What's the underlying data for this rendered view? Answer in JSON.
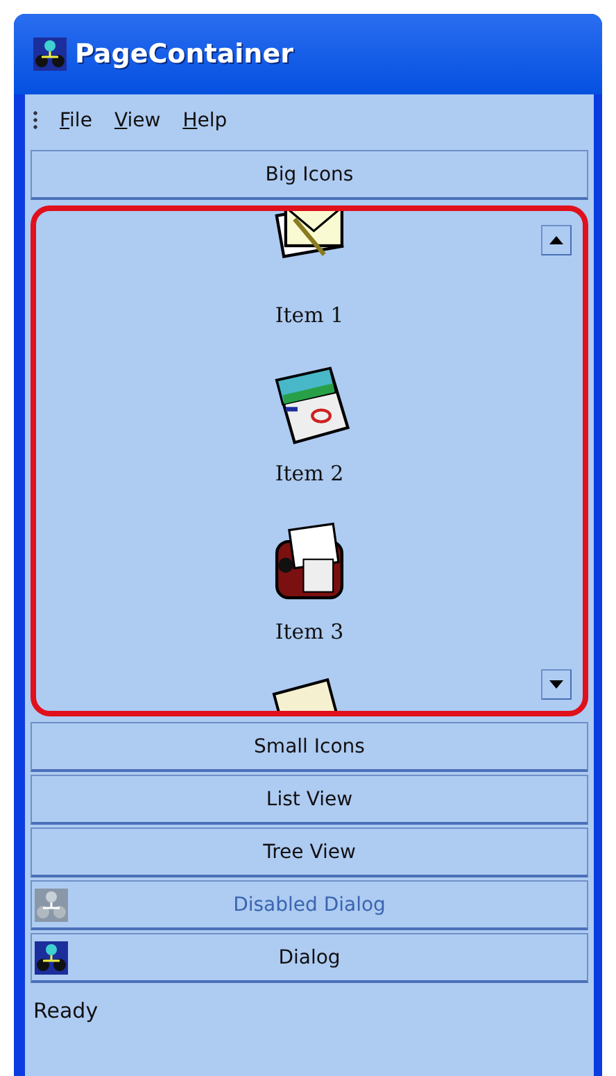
{
  "window": {
    "title": "PageContainer"
  },
  "menu": [
    {
      "label": "File"
    },
    {
      "label": "View"
    },
    {
      "label": "Help"
    }
  ],
  "pages": [
    {
      "label": "Big Icons",
      "kind": "plain",
      "disabled": false,
      "items": [
        "Item 1",
        "Item 2",
        "Item 3"
      ]
    },
    {
      "label": "Small Icons",
      "kind": "plain",
      "disabled": false
    },
    {
      "label": "List View",
      "kind": "plain",
      "disabled": false
    },
    {
      "label": "Tree View",
      "kind": "plain",
      "disabled": false
    },
    {
      "label": "Disabled Dialog",
      "kind": "icon",
      "disabled": true
    },
    {
      "label": "Dialog",
      "kind": "icon",
      "disabled": false
    }
  ],
  "status_bar": "Ready"
}
